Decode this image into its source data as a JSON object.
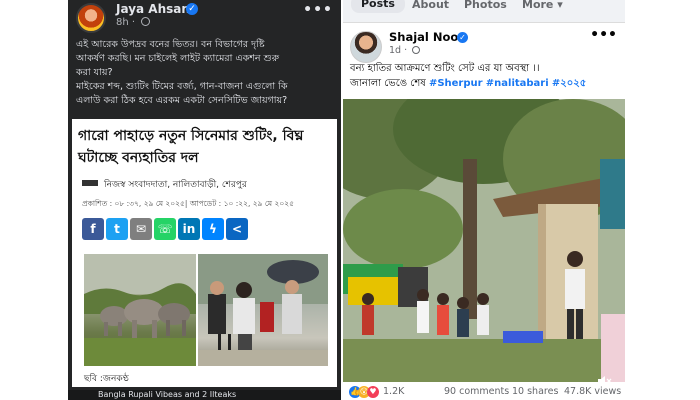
{
  "left_post": {
    "author": "Jaya Ahsan",
    "time": "8h",
    "more": "•••",
    "text_lines": [
      "এই আরেক উপদ্রব বনের ভিতর। বন বিভাগের দৃষ্টি",
      "আকর্ষণ করছি। মন চাইলেই লাইট ক্যামেরা একশন শুরু",
      "করা যায়?",
      "মাইকের শব্দ, শ্যুটিং টিমের বর্জ্য, গান-বাজনা এগুলো কি",
      "এলাউ করা ঠিক হবে এরকম একটা সেনসিটিভ জায়গায়?"
    ],
    "clipping": {
      "headline": "গারো পাহাড়ে নতুন সিনেমার শুটিং, বিঘ্ন ঘটাচ্ছে বন্যহাতির দল",
      "byline": "নিজস্ব সংবাদদাতা, নালিতাবাড়ী, শেরপুর",
      "published": "প্রকাশিত : ০৮ :৩৭, ২৯ মে ২০২৫| আপডেট : ১০ :২২, ২৯ মে ২০২৫",
      "share_buttons": [
        {
          "name": "facebook",
          "glyph": "f",
          "color": "#3b5998"
        },
        {
          "name": "twitter",
          "glyph": "t",
          "color": "#1da1f2"
        },
        {
          "name": "email",
          "glyph": "✉",
          "color": "#7f7f7f"
        },
        {
          "name": "whatsapp",
          "glyph": "☏",
          "color": "#25d366"
        },
        {
          "name": "linkedin",
          "glyph": "in",
          "color": "#0077b5"
        },
        {
          "name": "messenger",
          "glyph": "ϟ",
          "color": "#0084ff"
        },
        {
          "name": "share",
          "glyph": "<",
          "color": "#0a66c2"
        }
      ],
      "caption": "ছবি :জনকণ্ঠ"
    },
    "bottom_text": "Bangla Rupali Vibeas and 2 Ilteaks"
  },
  "right_post": {
    "tabs": [
      {
        "label": "Posts",
        "active": true
      },
      {
        "label": "About",
        "active": false
      },
      {
        "label": "Photos",
        "active": false
      },
      {
        "label": "More ▾",
        "active": false
      }
    ],
    "author": "Shajal Noor",
    "time": "1d",
    "more": "•••",
    "text_line1": "বন্য হাতির আক্রমণে শুটিং সেট এর যা অবস্থা ।।",
    "text_line2_prefix": "জানালা ভেঙে শেষ ",
    "hashtags": [
      "#Sherpur",
      "#nalitabari",
      "#২০২৫"
    ],
    "reaction_count": "1.2K",
    "comments": "90 comments",
    "shares": "10 shares",
    "views": "47.8K views"
  }
}
